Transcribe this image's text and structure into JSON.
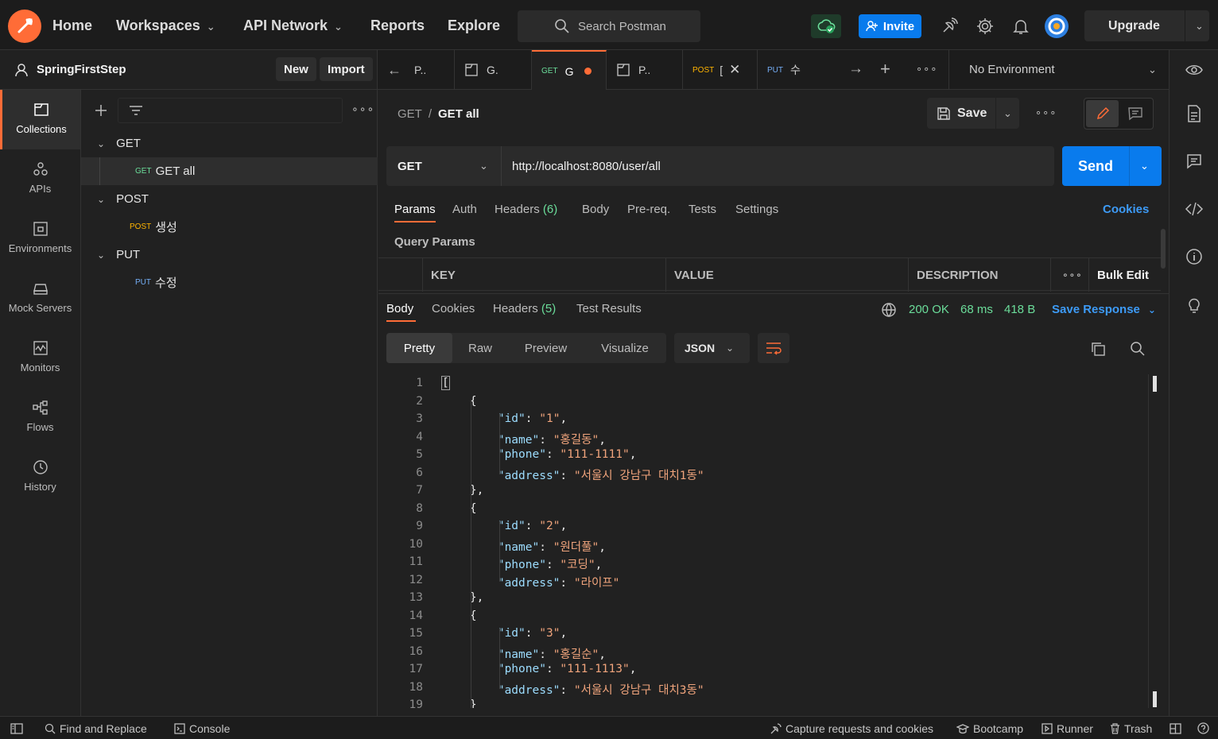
{
  "topbar": {
    "nav": [
      "Home",
      "Workspaces",
      "API Network",
      "Reports",
      "Explore"
    ],
    "search_placeholder": "Search Postman",
    "invite_label": "Invite",
    "upgrade_label": "Upgrade"
  },
  "workspace": {
    "name": "SpringFirstStep",
    "new_label": "New",
    "import_label": "Import"
  },
  "rail": [
    "Collections",
    "APIs",
    "Environments",
    "Mock Servers",
    "Monitors",
    "Flows",
    "History"
  ],
  "tree": {
    "folders": [
      {
        "name": "GET",
        "item_method": "GET",
        "item_name": "GET all"
      },
      {
        "name": "POST",
        "item_method": "POST",
        "item_name": "생성"
      },
      {
        "name": "PUT",
        "item_method": "PUT",
        "item_name": "수정"
      }
    ]
  },
  "tabs": [
    {
      "method": "",
      "label": "P.."
    },
    {
      "method": "",
      "label": "G."
    },
    {
      "method": "GET",
      "label": "G"
    },
    {
      "method": "",
      "label": "P.."
    },
    {
      "method": "POST",
      "label": "["
    },
    {
      "method": "PUT",
      "label": "수"
    }
  ],
  "environment": "No Environment",
  "request": {
    "breadcrumb_parent": "GET",
    "breadcrumb_sep": "/",
    "breadcrumb_name": "GET all",
    "save_label": "Save",
    "method": "GET",
    "url": "http://localhost:8080/user/all",
    "send_label": "Send",
    "subtabs": [
      "Params",
      "Auth",
      "Headers",
      "Body",
      "Pre-req.",
      "Tests",
      "Settings"
    ],
    "headers_count": "(6)",
    "cookies_label": "Cookies",
    "query_params_label": "Query Params",
    "columns": [
      "KEY",
      "VALUE",
      "DESCRIPTION"
    ],
    "bulk_edit": "Bulk Edit"
  },
  "response": {
    "tabs": [
      "Body",
      "Cookies",
      "Headers",
      "Test Results"
    ],
    "headers_count": "(5)",
    "status": "200 OK",
    "time": "68 ms",
    "size": "418 B",
    "save_response": "Save Response",
    "views": [
      "Pretty",
      "Raw",
      "Preview",
      "Visualize"
    ],
    "format": "JSON",
    "lines": [
      "[",
      "    {",
      "        \"id\": \"1\",",
      "        \"name\": \"홍길동\",",
      "        \"phone\": \"111-1111\",",
      "        \"address\": \"서울시 강남구 대치1동\"",
      "    },",
      "    {",
      "        \"id\": \"2\",",
      "        \"name\": \"원더풀\",",
      "        \"phone\": \"코딩\",",
      "        \"address\": \"라이프\"",
      "    },",
      "    {",
      "        \"id\": \"3\",",
      "        \"name\": \"홍길순\",",
      "        \"phone\": \"111-1113\",",
      "        \"address\": \"서울시 강남구 대치3동\"",
      "    }"
    ]
  },
  "statusbar": {
    "find_replace": "Find and Replace",
    "console": "Console",
    "capture": "Capture requests and cookies",
    "bootcamp": "Bootcamp",
    "runner": "Runner",
    "trash": "Trash"
  },
  "colors": {
    "accent": "#ff6c37",
    "primary": "#097bed",
    "get": "#6bdd9a",
    "post": "#ffb400",
    "put": "#74aef6"
  }
}
